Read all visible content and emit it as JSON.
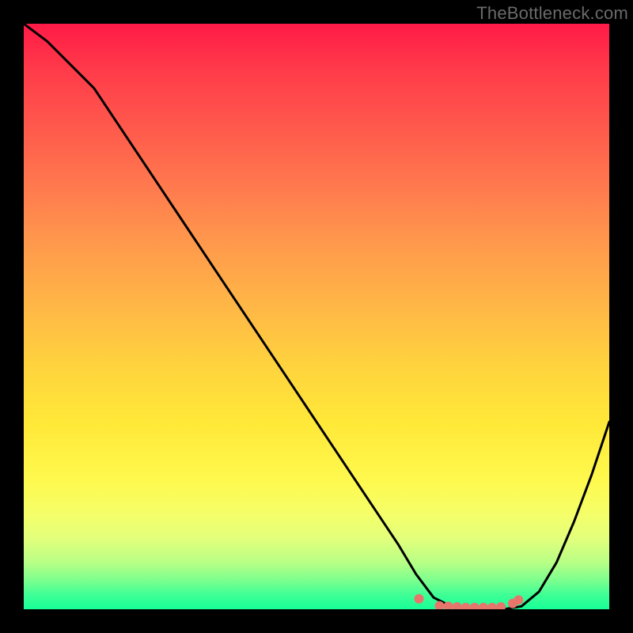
{
  "watermark": "TheBottleneck.com",
  "colors": {
    "frame": "#000000",
    "curve": "#000000",
    "marker": "#e6766c"
  },
  "chart_data": {
    "type": "line",
    "title": "",
    "xlabel": "",
    "ylabel": "",
    "xlim": [
      0,
      100
    ],
    "ylim": [
      0,
      100
    ],
    "grid": false,
    "legend": false,
    "annotations": [
      "TheBottleneck.com"
    ],
    "series": [
      {
        "name": "bottleneck-curve",
        "x": [
          0,
          4,
          8,
          12,
          16,
          20,
          24,
          28,
          32,
          36,
          40,
          44,
          48,
          52,
          56,
          60,
          64,
          67,
          70,
          73,
          76,
          79,
          82,
          85,
          88,
          91,
          94,
          97,
          100
        ],
        "values": [
          100,
          97,
          93,
          89,
          83,
          77,
          71,
          65,
          59,
          53,
          47,
          41,
          35,
          29,
          23,
          17,
          11,
          6,
          2,
          0.5,
          0,
          0,
          0,
          0.5,
          3,
          8,
          15,
          23,
          32
        ]
      }
    ],
    "markers": {
      "name": "flat-region-dots",
      "x": [
        67.5,
        71.0,
        72.5,
        74.0,
        75.5,
        77.0,
        78.5,
        80.0,
        81.5,
        83.5,
        84.5
      ],
      "values": [
        1.8,
        0.6,
        0.5,
        0.4,
        0.3,
        0.3,
        0.3,
        0.3,
        0.4,
        1.0,
        1.6
      ]
    }
  }
}
